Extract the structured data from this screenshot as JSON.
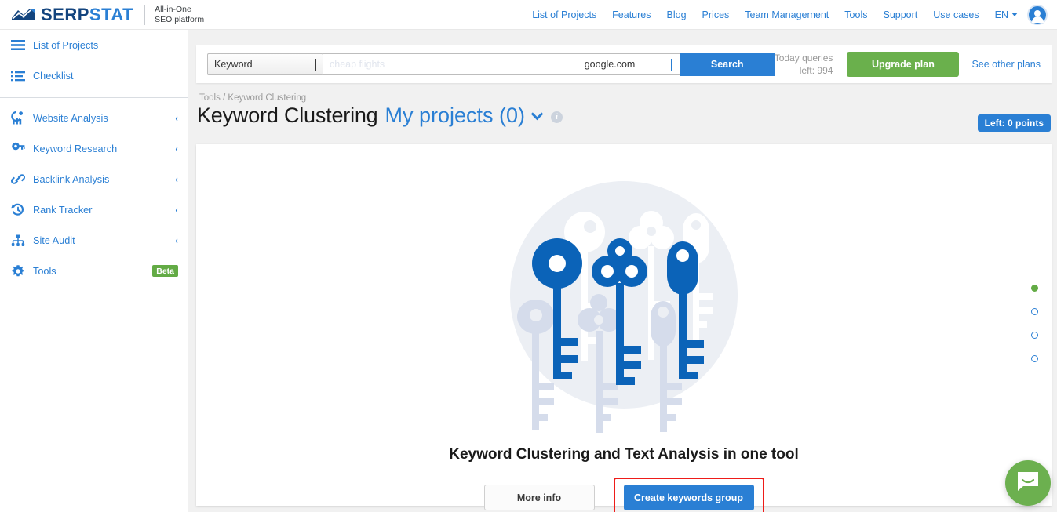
{
  "brand": {
    "name_dark": "SERP",
    "name_light": "STAT",
    "tagline_line1": "All-in-One",
    "tagline_line2": "SEO platform",
    "logo_icon": "serpstat-wave-logo-icon",
    "color_dark": "#13447e",
    "color_light": "#2a7fd4"
  },
  "topnav": {
    "items": [
      {
        "label": "List of Projects"
      },
      {
        "label": "Features"
      },
      {
        "label": "Blog"
      },
      {
        "label": "Prices"
      },
      {
        "label": "Team Management"
      },
      {
        "label": "Tools"
      },
      {
        "label": "Support"
      },
      {
        "label": "Use cases"
      }
    ],
    "language": "EN",
    "avatar_icon": "user-avatar-icon"
  },
  "sidebar": {
    "items": [
      {
        "label": "List of Projects",
        "icon": "hamburger-menu-icon",
        "expandable": false,
        "badge": ""
      },
      {
        "label": "Checklist",
        "icon": "checklist-icon",
        "expandable": false,
        "badge": ""
      },
      {
        "label": "Website Analysis",
        "icon": "analytics-chart-icon",
        "expandable": true,
        "badge": ""
      },
      {
        "label": "Keyword Research",
        "icon": "key-icon",
        "expandable": true,
        "badge": ""
      },
      {
        "label": "Backlink Analysis",
        "icon": "link-chain-icon",
        "expandable": true,
        "badge": ""
      },
      {
        "label": "Rank Tracker",
        "icon": "history-clock-icon",
        "expandable": true,
        "badge": ""
      },
      {
        "label": "Site Audit",
        "icon": "sitemap-icon",
        "expandable": true,
        "badge": ""
      },
      {
        "label": "Tools",
        "icon": "gear-icon",
        "expandable": false,
        "badge": "Beta"
      }
    ],
    "collapse_arrow": "‹"
  },
  "search": {
    "mode_selected": "Keyword",
    "query_value": "",
    "query_placeholder": "cheap flights",
    "database_selected": "google.com",
    "search_button": "Search",
    "quota_line1": "Today queries",
    "quota_line2": "left: 994",
    "upgrade_button": "Upgrade plan",
    "other_plans_link": "See other plans"
  },
  "breadcrumb": "Tools / Keyword Clustering",
  "page": {
    "title": "Keyword Clustering",
    "project_selector": "My projects (0)",
    "project_chevron_icon": "chevron-down-icon",
    "info_icon": "info-circle-icon",
    "points_badge": "Left: 0 points"
  },
  "empty_state": {
    "illustration_icon": "keys-illustration-icon",
    "headline": "Keyword Clustering and Text Analysis in one tool",
    "more_info_button": "More info",
    "primary_button": "Create keywords group",
    "highlight_color": "#ee1c19"
  },
  "carousel": {
    "dots": [
      {
        "state": "active",
        "color": "#63ab45"
      },
      {
        "state": "inactive",
        "color": "#2a7fd4"
      },
      {
        "state": "inactive",
        "color": "#2a7fd4"
      },
      {
        "state": "inactive",
        "color": "#2a7fd4"
      }
    ]
  },
  "chat_widget": {
    "icon": "chat-bubble-smile-icon",
    "color": "#6cb04f"
  }
}
